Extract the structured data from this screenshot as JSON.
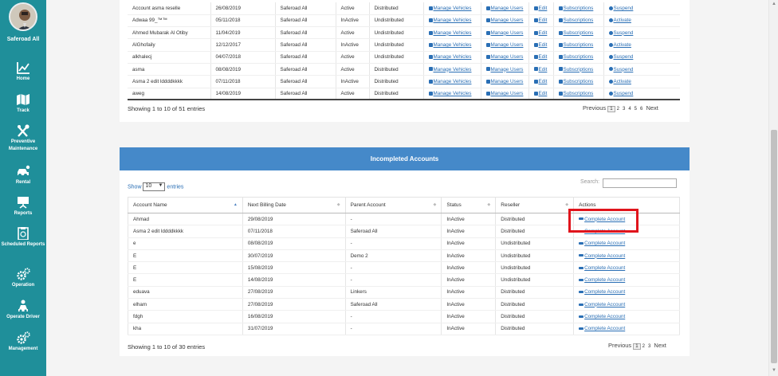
{
  "sidebar": {
    "brand": "Saferoad All",
    "items": [
      {
        "label": "Home",
        "icon": "chart-icon"
      },
      {
        "label": "Track",
        "icon": "map-icon"
      },
      {
        "label": "Preventive Maintenance",
        "icon": "tools-icon"
      },
      {
        "label": "Rental",
        "icon": "car-icon"
      },
      {
        "label": "Reports",
        "icon": "presentation-icon"
      },
      {
        "label": "Scheduled Reports",
        "icon": "clipboard-icon"
      },
      {
        "label": "Operation",
        "icon": "gears-icon"
      },
      {
        "label": "Operate Driver",
        "icon": "driver-icon"
      },
      {
        "label": "Management",
        "icon": "gears-icon"
      }
    ]
  },
  "accounts_table": {
    "rows": [
      {
        "name": "Account asma reselle",
        "date": "26/08/2019",
        "parent": "Saferoad All",
        "status": "Active",
        "reseller": "Distributed",
        "toggle": "Suspend"
      },
      {
        "name": "Adwaa 99_™™",
        "date": "05/11/2018",
        "parent": "Saferoad All",
        "status": "InActive",
        "reseller": "Undistributed",
        "toggle": "Activate"
      },
      {
        "name": "Ahmed Mubarak Al Otiby",
        "date": "11/04/2019",
        "parent": "Saferoad All",
        "status": "Active",
        "reseller": "Undistributed",
        "toggle": "Suspend"
      },
      {
        "name": "AlGhofaily",
        "date": "12/12/2017",
        "parent": "Saferoad All",
        "status": "InActive",
        "reseller": "Undistributed",
        "toggle": "Activate"
      },
      {
        "name": "alkhalecj",
        "date": "04/07/2018",
        "parent": "Saferoad All",
        "status": "Active",
        "reseller": "Undistributed",
        "toggle": "Suspend"
      },
      {
        "name": "asma",
        "date": "08/08/2019",
        "parent": "Saferoad All",
        "status": "Active",
        "reseller": "Distributed",
        "toggle": "Suspend"
      },
      {
        "name": "Asma 2 edit lddddkkkk",
        "date": "07/11/2018",
        "parent": "Saferoad All",
        "status": "InActive",
        "reseller": "Distributed",
        "toggle": "Activate"
      },
      {
        "name": "aweg",
        "date": "14/08/2019",
        "parent": "Saferoad All",
        "status": "Active",
        "reseller": "Distributed",
        "toggle": "Suspend"
      }
    ],
    "actions": {
      "vehicles": "Manage Vehicles",
      "users": "Manage Users",
      "edit": "Edit",
      "subs": "Subscriptions"
    },
    "info": "Showing 1 to 10 of 51 entries",
    "pager": {
      "prev": "Previous",
      "pages": [
        "1",
        "2",
        "3",
        "4",
        "5",
        "6"
      ],
      "next": "Next"
    }
  },
  "incomplete": {
    "title": "Incompleted Accounts",
    "show_label": "Show",
    "show_value": "10",
    "entries_label": "entries",
    "search_label": "Search:",
    "headers": [
      "Account Name",
      "Next Billing Date",
      "Parent Account",
      "Status",
      "Reseller",
      "Actions"
    ],
    "rows": [
      {
        "name": "Ahmad",
        "date": "29/08/2019",
        "parent": "-",
        "status": "InActive",
        "reseller": "Distributed"
      },
      {
        "name": "Asma 2 edit lddddkkkk",
        "date": "07/11/2018",
        "parent": "Saferoad All",
        "status": "InActive",
        "reseller": "Distributed"
      },
      {
        "name": "e",
        "date": "08/08/2019",
        "parent": "-",
        "status": "InActive",
        "reseller": "Undistributed"
      },
      {
        "name": "E",
        "date": "30/07/2019",
        "parent": "Demo 2",
        "status": "InActive",
        "reseller": "Undistributed"
      },
      {
        "name": "E",
        "date": "15/08/2019",
        "parent": "-",
        "status": "InActive",
        "reseller": "Undistributed"
      },
      {
        "name": "E",
        "date": "14/08/2019",
        "parent": "-",
        "status": "InActive",
        "reseller": "Undistributed"
      },
      {
        "name": "eduava",
        "date": "27/08/2019",
        "parent": "Linkers",
        "status": "InActive",
        "reseller": "Distributed"
      },
      {
        "name": "elham",
        "date": "27/08/2019",
        "parent": "Saferoad All",
        "status": "InActive",
        "reseller": "Distributed"
      },
      {
        "name": "fdgh",
        "date": "16/08/2019",
        "parent": "-",
        "status": "InActive",
        "reseller": "Distributed"
      },
      {
        "name": "kha",
        "date": "31/07/2019",
        "parent": "-",
        "status": "InActive",
        "reseller": "Distributed"
      }
    ],
    "action_label": "Complete Account",
    "info": "Showing 1 to 10 of 30 entries",
    "pager": {
      "prev": "Previous",
      "pages": [
        "1",
        "2",
        "3"
      ],
      "next": "Next"
    }
  },
  "colors": {
    "sidebar": "#1f8f9a",
    "panel_header": "#4589c9",
    "link": "#2a6fb5",
    "highlight": "#e0141c"
  }
}
